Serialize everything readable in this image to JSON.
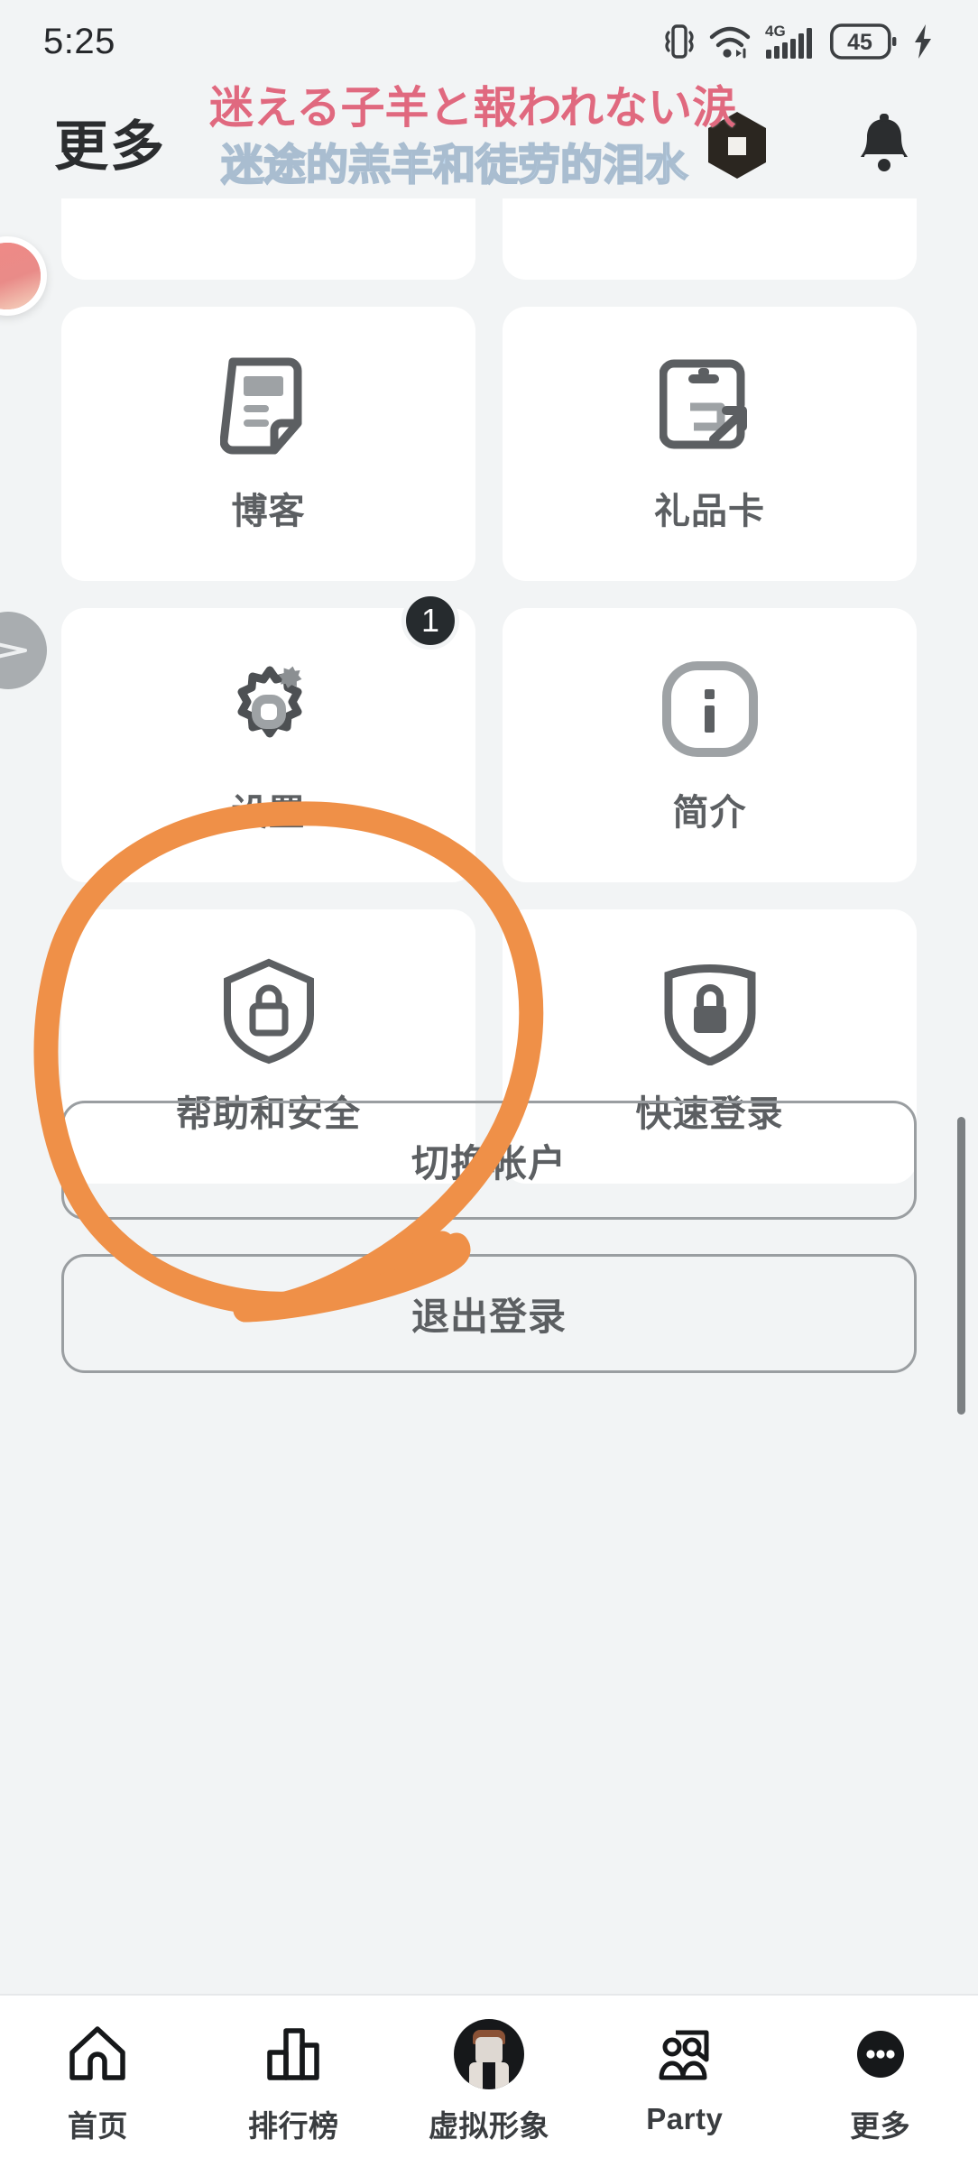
{
  "statusbar": {
    "time": "5:25",
    "icons": [
      "vibrate-icon",
      "wifi-icon",
      "signal-4g-icon",
      "battery-icon",
      "charging-bolt-icon"
    ],
    "network_label": "4G",
    "battery_level": "45"
  },
  "header": {
    "title": "更多",
    "logo_name": "roblox-logo",
    "notifications_label": "通知",
    "overlay_line1": "迷える子羊と報われない涙",
    "overlay_line2": "迷途的羔羊和徒劳的泪水",
    "overlay_line1_color": "#e0697f",
    "overlay_line2_color": "#c1d9ef"
  },
  "grid": {
    "clipped_row": [
      {
        "name": "card-clipped-left"
      },
      {
        "name": "card-clipped-right"
      }
    ],
    "items": [
      {
        "label": "博客",
        "icon": "blog-note-icon",
        "badge": null
      },
      {
        "label": "礼品卡",
        "icon": "gift-card-icon",
        "badge": null
      },
      {
        "label": "设置",
        "icon": "settings-gear-icon",
        "badge": "1"
      },
      {
        "label": "简介",
        "icon": "info-icon",
        "badge": null
      },
      {
        "label": "帮助和安全",
        "icon": "shield-lock-outline-icon",
        "badge": null
      },
      {
        "label": "快速登录",
        "icon": "shield-lock-filled-icon",
        "badge": null
      }
    ]
  },
  "actions": {
    "switch_account": "切换帐户",
    "logout": "退出登录"
  },
  "annotation": {
    "shape": "hand-drawn-circle",
    "color": "#ef9048",
    "target": "设置"
  },
  "overlays": {
    "avatar_bubble": "floating-avatar-bubble",
    "send_bubble": "floating-send-bubble",
    "scrollbar": "vertical-scrollbar"
  },
  "bottomnav": {
    "items": [
      {
        "label": "首页",
        "icon": "home-icon"
      },
      {
        "label": "排行榜",
        "icon": "charts-bar-icon"
      },
      {
        "label": "虚拟形象",
        "icon": "avatar-icon"
      },
      {
        "label": "Party",
        "icon": "party-people-icon"
      },
      {
        "label": "更多",
        "icon": "more-dots-icon"
      }
    ],
    "active": "更多"
  }
}
